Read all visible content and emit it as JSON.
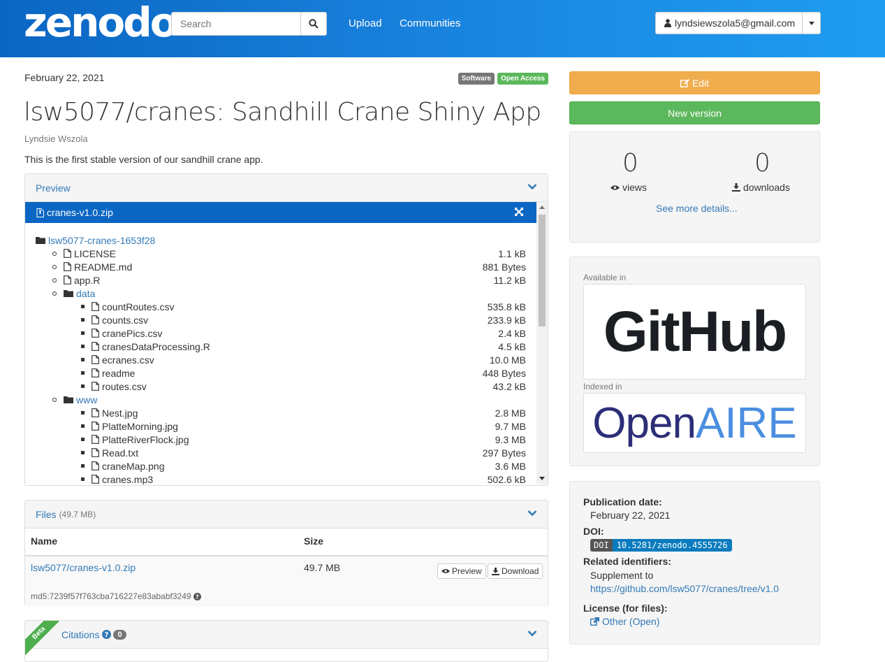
{
  "header": {
    "logo": "zenodo",
    "search_placeholder": "Search",
    "nav": [
      "Upload",
      "Communities"
    ],
    "user": "lyndsiewszola5@gmail.com"
  },
  "record": {
    "date": "February 22, 2021",
    "badges": [
      {
        "label": "Software",
        "color": "#777777"
      },
      {
        "label": "Open Access",
        "color": "#5cb85c"
      }
    ],
    "title": "lsw5077/cranes: Sandhill Crane Shiny App",
    "author": "Lyndsie Wszola",
    "description": "This is the first stable version of our sandhill crane app."
  },
  "preview": {
    "heading": "Preview",
    "file": "cranes-v1.0.zip",
    "root": "lsw5077-cranes-1653f28",
    "top_files": [
      {
        "name": "LICENSE",
        "size": "1.1 kB"
      },
      {
        "name": "README.md",
        "size": "881 Bytes"
      },
      {
        "name": "app.R",
        "size": "11.2 kB"
      }
    ],
    "data_folder": "data",
    "data_files": [
      {
        "name": "countRoutes.csv",
        "size": "535.8 kB"
      },
      {
        "name": "counts.csv",
        "size": "233.9 kB"
      },
      {
        "name": "cranePics.csv",
        "size": "2.4 kB"
      },
      {
        "name": "cranesDataProcessing.R",
        "size": "4.5 kB"
      },
      {
        "name": "ecranes.csv",
        "size": "10.0 MB"
      },
      {
        "name": "readme",
        "size": "448 Bytes"
      },
      {
        "name": "routes.csv",
        "size": "43.2 kB"
      }
    ],
    "www_folder": "www",
    "www_files": [
      {
        "name": "Nest.jpg",
        "size": "2.8 MB"
      },
      {
        "name": "PlatteMorning.jpg",
        "size": "9.7 MB"
      },
      {
        "name": "PlatteRiverFlock.jpg",
        "size": "9.3 MB"
      },
      {
        "name": "Read.txt",
        "size": "297 Bytes"
      },
      {
        "name": "craneMap.png",
        "size": "3.6 MB"
      },
      {
        "name": "cranes.mp3",
        "size": "502.6 kB"
      }
    ]
  },
  "files": {
    "heading": "Files",
    "total": "(49.7 MB)",
    "col_name": "Name",
    "col_size": "Size",
    "file_name": "lsw5077/cranes-v1.0.zip",
    "file_size": "49.7 MB",
    "preview_btn": "Preview",
    "download_btn": "Download",
    "md5": "md5:7239f57f763cba716227e83ababf3249"
  },
  "citations": {
    "ribbon": "Beta",
    "heading": "Citations",
    "count": "0"
  },
  "sidebar": {
    "edit": "Edit",
    "new_version": "New version",
    "views_count": "0",
    "views_label": "views",
    "downloads_count": "0",
    "downloads_label": "downloads",
    "more": "See more details...",
    "available_in": "Available in",
    "github": "GitHub",
    "indexed_in": "Indexed in",
    "openaire_a": "Open",
    "openaire_b": "AIRE",
    "pub_date_label": "Publication date:",
    "pub_date": "February 22, 2021",
    "doi_label": "DOI:",
    "doi_prefix": "DOI",
    "doi": "10.5281/zenodo.4555726",
    "related_label": "Related identifiers:",
    "supplement": "Supplement to",
    "related_url": "https://github.com/lsw5077/cranes/tree/v1.0",
    "license_label": "License (for files):",
    "license": "Other (Open)"
  },
  "colors": {
    "header": "#0b66c3",
    "edit": "#f0ad4e",
    "new_version": "#5cb85c",
    "link": "#337ab7",
    "doi": "#0a7bbe"
  }
}
